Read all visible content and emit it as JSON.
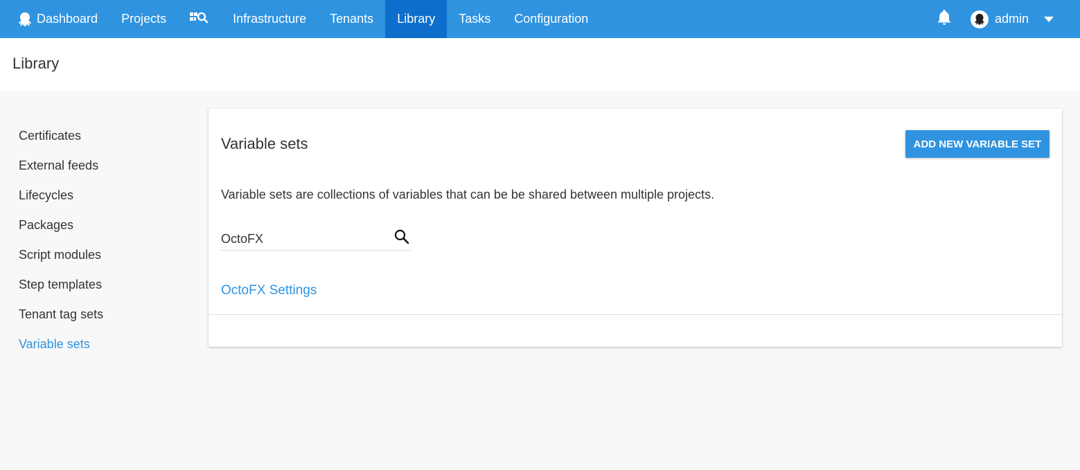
{
  "nav": {
    "items": [
      {
        "label": "Dashboard",
        "icon": "octopus-icon",
        "active": false
      },
      {
        "label": "Projects",
        "active": false
      },
      {
        "label": "",
        "icon": "project-search-icon",
        "active": false
      },
      {
        "label": "Infrastructure",
        "active": false
      },
      {
        "label": "Tenants",
        "active": false
      },
      {
        "label": "Library",
        "active": true
      },
      {
        "label": "Tasks",
        "active": false
      },
      {
        "label": "Configuration",
        "active": false
      }
    ],
    "notifications_icon": "bell-icon",
    "user": {
      "name": "admin",
      "avatar_icon": "octopus-avatar-icon",
      "menu_icon": "caret-down-icon"
    }
  },
  "page": {
    "title": "Library"
  },
  "sidebar": {
    "items": [
      {
        "label": "Certificates",
        "active": false
      },
      {
        "label": "External feeds",
        "active": false
      },
      {
        "label": "Lifecycles",
        "active": false
      },
      {
        "label": "Packages",
        "active": false
      },
      {
        "label": "Script modules",
        "active": false
      },
      {
        "label": "Step templates",
        "active": false
      },
      {
        "label": "Tenant tag sets",
        "active": false
      },
      {
        "label": "Variable sets",
        "active": true
      }
    ]
  },
  "main": {
    "title": "Variable sets",
    "add_button": "ADD NEW VARIABLE SET",
    "description": "Variable sets are collections of variables that can be be shared between multiple projects.",
    "search": {
      "value": "OctoFX",
      "placeholder": ""
    },
    "results": [
      {
        "label": "OctoFX Settings"
      }
    ]
  },
  "colors": {
    "accent": "#2f93e0",
    "nav_active": "#0d6ecc",
    "background": "#f8f8f8"
  }
}
